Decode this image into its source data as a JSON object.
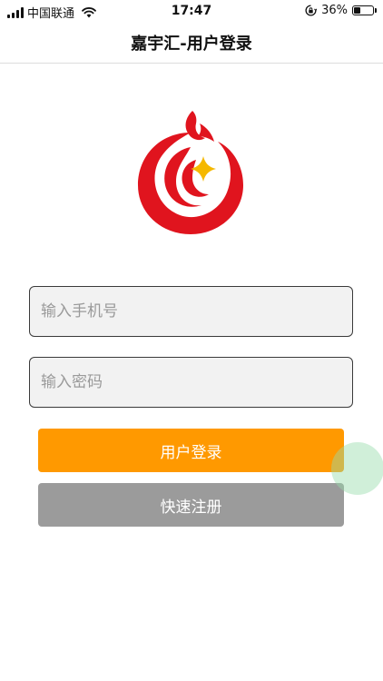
{
  "status_bar": {
    "carrier": "中国联通",
    "time": "17:47",
    "battery_percent": "36%",
    "battery_level": 0.36,
    "icons": [
      "signal-icon",
      "wifi-icon",
      "orientation-lock-icon",
      "battery-icon"
    ]
  },
  "header": {
    "title": "嘉宇汇-用户登录"
  },
  "logo": {
    "icon": "brand-logo-icon",
    "colors": {
      "red": "#e0141e",
      "gold": "#f5b800"
    }
  },
  "form": {
    "phone_placeholder": "输入手机号",
    "phone_value": "",
    "password_placeholder": "输入密码",
    "password_value": ""
  },
  "buttons": {
    "login_label": "用户登录",
    "register_label": "快速注册"
  },
  "colors": {
    "login_button": "#ff9900",
    "register_button": "#9b9b9b",
    "input_background": "#f2f2f2",
    "input_border": "#3a3a3a",
    "touch_indicator": "#96dcaa"
  }
}
